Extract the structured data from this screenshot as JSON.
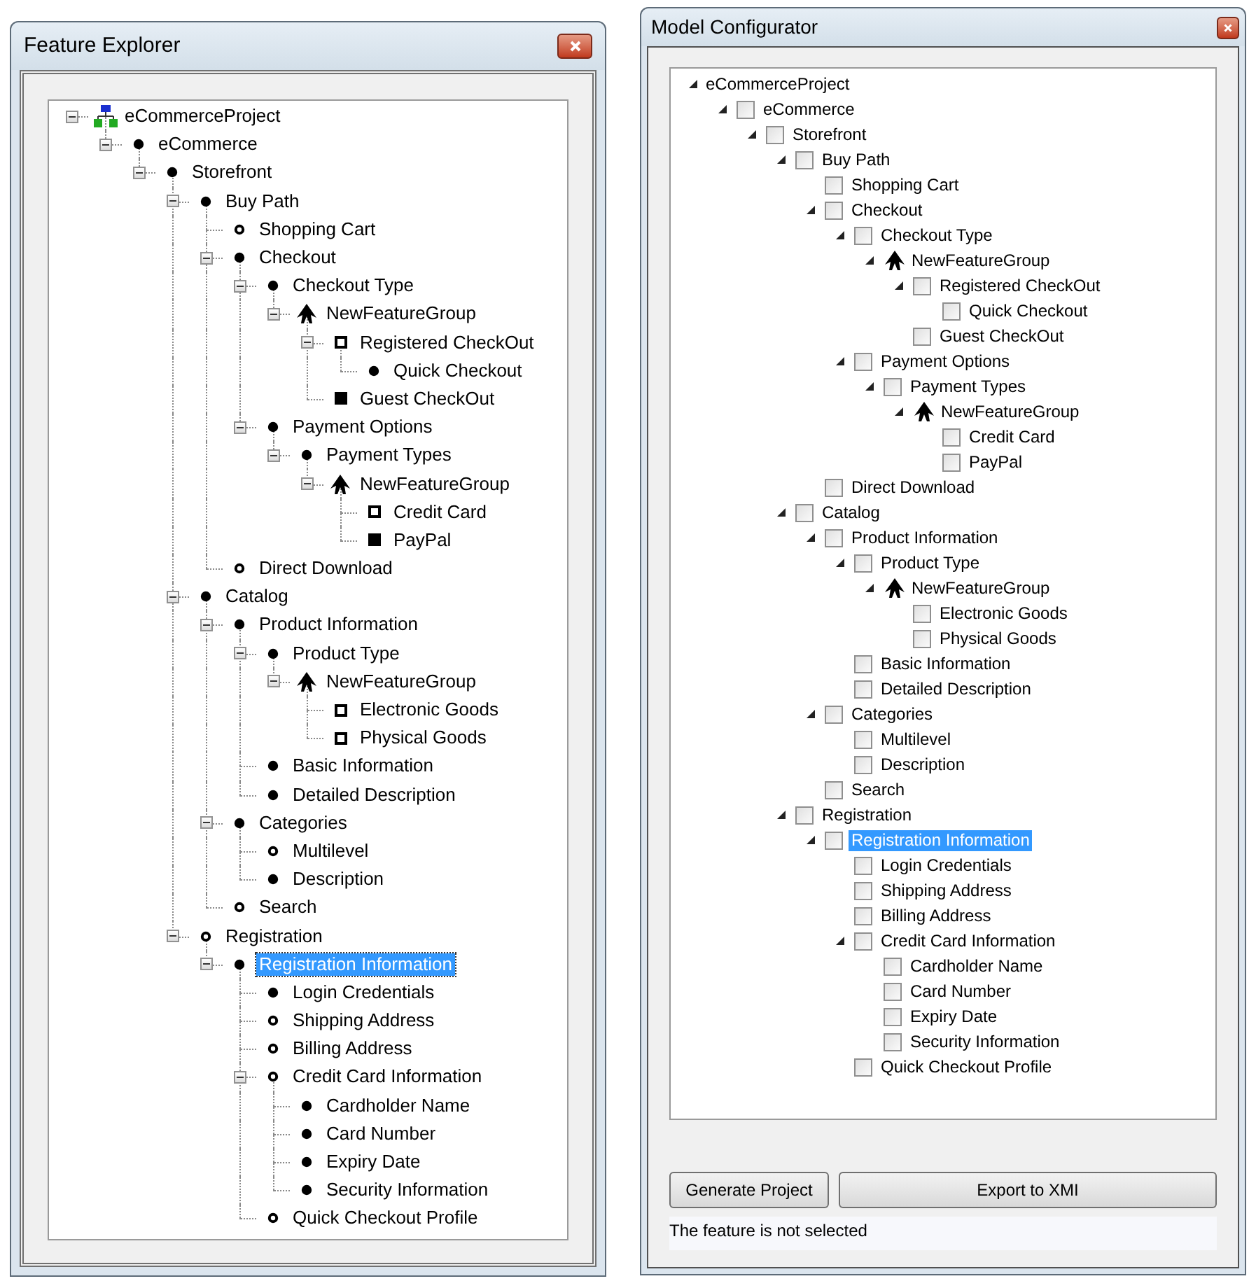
{
  "feature_explorer": {
    "title": "Feature Explorer",
    "tree": [
      {
        "label": "eCommerceProject",
        "kind": "root",
        "expanded": true,
        "selected": false,
        "children": [
          {
            "label": "eCommerce",
            "kind": "mandatory",
            "expanded": true,
            "selected": false,
            "children": [
              {
                "label": "Storefront",
                "kind": "mandatory",
                "expanded": true,
                "selected": false,
                "children": [
                  {
                    "label": "Buy Path",
                    "kind": "mandatory",
                    "expanded": true,
                    "selected": false,
                    "children": [
                      {
                        "label": "Shopping Cart",
                        "kind": "optional",
                        "selected": false
                      },
                      {
                        "label": "Checkout",
                        "kind": "mandatory",
                        "expanded": true,
                        "selected": false,
                        "children": [
                          {
                            "label": "Checkout Type",
                            "kind": "mandatory",
                            "expanded": true,
                            "selected": false,
                            "children": [
                              {
                                "label": "NewFeatureGroup",
                                "kind": "group",
                                "expanded": true,
                                "selected": false,
                                "children": [
                                  {
                                    "label": "Registered CheckOut",
                                    "kind": "or",
                                    "expanded": true,
                                    "selected": false,
                                    "children": [
                                      {
                                        "label": "Quick Checkout",
                                        "kind": "mandatory",
                                        "selected": false
                                      }
                                    ]
                                  },
                                  {
                                    "label": "Guest CheckOut",
                                    "kind": "alternative",
                                    "selected": false
                                  }
                                ]
                              }
                            ]
                          },
                          {
                            "label": "Payment Options",
                            "kind": "mandatory",
                            "expanded": true,
                            "selected": false,
                            "children": [
                              {
                                "label": "Payment Types",
                                "kind": "mandatory",
                                "expanded": true,
                                "selected": false,
                                "children": [
                                  {
                                    "label": "NewFeatureGroup",
                                    "kind": "group",
                                    "expanded": true,
                                    "selected": false,
                                    "children": [
                                      {
                                        "label": "Credit Card",
                                        "kind": "or",
                                        "selected": false
                                      },
                                      {
                                        "label": "PayPal",
                                        "kind": "alternative",
                                        "selected": false
                                      }
                                    ]
                                  }
                                ]
                              }
                            ]
                          }
                        ]
                      },
                      {
                        "label": "Direct Download",
                        "kind": "optional",
                        "selected": false
                      }
                    ]
                  },
                  {
                    "label": "Catalog",
                    "kind": "mandatory",
                    "expanded": true,
                    "selected": false,
                    "children": [
                      {
                        "label": "Product Information",
                        "kind": "mandatory",
                        "expanded": true,
                        "selected": false,
                        "children": [
                          {
                            "label": "Product Type",
                            "kind": "mandatory",
                            "expanded": true,
                            "selected": false,
                            "children": [
                              {
                                "label": "NewFeatureGroup",
                                "kind": "group",
                                "expanded": true,
                                "selected": false,
                                "children": [
                                  {
                                    "label": "Electronic Goods",
                                    "kind": "or",
                                    "selected": false
                                  },
                                  {
                                    "label": "Physical Goods",
                                    "kind": "or",
                                    "selected": false
                                  }
                                ]
                              }
                            ]
                          },
                          {
                            "label": "Basic Information",
                            "kind": "mandatory",
                            "selected": false
                          },
                          {
                            "label": "Detailed Description",
                            "kind": "mandatory",
                            "selected": false
                          }
                        ]
                      },
                      {
                        "label": "Categories",
                        "kind": "mandatory",
                        "expanded": true,
                        "selected": false,
                        "children": [
                          {
                            "label": "Multilevel",
                            "kind": "optional",
                            "selected": false
                          },
                          {
                            "label": "Description",
                            "kind": "mandatory",
                            "selected": false
                          }
                        ]
                      },
                      {
                        "label": "Search",
                        "kind": "optional",
                        "selected": false
                      }
                    ]
                  },
                  {
                    "label": "Registration",
                    "kind": "optional",
                    "expanded": true,
                    "selected": false,
                    "children": [
                      {
                        "label": "Registration Information",
                        "kind": "mandatory",
                        "expanded": true,
                        "selected": true,
                        "children": [
                          {
                            "label": "Login Credentials",
                            "kind": "mandatory",
                            "selected": false
                          },
                          {
                            "label": "Shipping Address",
                            "kind": "optional",
                            "selected": false
                          },
                          {
                            "label": "Billing Address",
                            "kind": "optional",
                            "selected": false
                          },
                          {
                            "label": "Credit Card Information",
                            "kind": "optional",
                            "expanded": true,
                            "selected": false,
                            "children": [
                              {
                                "label": "Cardholder Name",
                                "kind": "mandatory",
                                "selected": false
                              },
                              {
                                "label": "Card Number",
                                "kind": "mandatory",
                                "selected": false
                              },
                              {
                                "label": "Expiry Date",
                                "kind": "mandatory",
                                "selected": false
                              },
                              {
                                "label": "Security Information",
                                "kind": "mandatory",
                                "selected": false
                              }
                            ]
                          },
                          {
                            "label": "Quick Checkout Profile",
                            "kind": "optional",
                            "selected": false
                          }
                        ]
                      }
                    ]
                  }
                ]
              }
            ]
          }
        ]
      }
    ]
  },
  "model_configurator": {
    "title": "Model Configurator",
    "tree": [
      {
        "label": "eCommerceProject",
        "kind": "root",
        "expanded": true,
        "selected": false,
        "children": [
          {
            "label": "eCommerce",
            "kind": "feature",
            "checked": false,
            "expanded": true,
            "selected": false,
            "children": [
              {
                "label": "Storefront",
                "kind": "feature",
                "checked": false,
                "expanded": true,
                "selected": false,
                "children": [
                  {
                    "label": "Buy Path",
                    "kind": "feature",
                    "checked": false,
                    "expanded": true,
                    "selected": false,
                    "children": [
                      {
                        "label": "Shopping Cart",
                        "kind": "feature",
                        "checked": false,
                        "selected": false
                      },
                      {
                        "label": "Checkout",
                        "kind": "feature",
                        "checked": false,
                        "expanded": true,
                        "selected": false,
                        "children": [
                          {
                            "label": "Checkout Type",
                            "kind": "feature",
                            "checked": false,
                            "expanded": true,
                            "selected": false,
                            "children": [
                              {
                                "label": "NewFeatureGroup",
                                "kind": "group",
                                "expanded": true,
                                "selected": false,
                                "children": [
                                  {
                                    "label": "Registered CheckOut",
                                    "kind": "feature",
                                    "checked": false,
                                    "expanded": true,
                                    "selected": false,
                                    "children": [
                                      {
                                        "label": "Quick Checkout",
                                        "kind": "feature",
                                        "checked": false,
                                        "selected": false
                                      }
                                    ]
                                  },
                                  {
                                    "label": "Guest CheckOut",
                                    "kind": "feature",
                                    "checked": false,
                                    "selected": false
                                  }
                                ]
                              }
                            ]
                          },
                          {
                            "label": "Payment Options",
                            "kind": "feature",
                            "checked": false,
                            "expanded": true,
                            "selected": false,
                            "children": [
                              {
                                "label": "Payment Types",
                                "kind": "feature",
                                "checked": false,
                                "expanded": true,
                                "selected": false,
                                "children": [
                                  {
                                    "label": "NewFeatureGroup",
                                    "kind": "group",
                                    "expanded": true,
                                    "selected": false,
                                    "children": [
                                      {
                                        "label": "Credit Card",
                                        "kind": "feature",
                                        "checked": false,
                                        "selected": false
                                      },
                                      {
                                        "label": "PayPal",
                                        "kind": "feature",
                                        "checked": false,
                                        "selected": false
                                      }
                                    ]
                                  }
                                ]
                              }
                            ]
                          }
                        ]
                      },
                      {
                        "label": "Direct Download",
                        "kind": "feature",
                        "checked": false,
                        "selected": false
                      }
                    ]
                  },
                  {
                    "label": "Catalog",
                    "kind": "feature",
                    "checked": false,
                    "expanded": true,
                    "selected": false,
                    "children": [
                      {
                        "label": "Product Information",
                        "kind": "feature",
                        "checked": false,
                        "expanded": true,
                        "selected": false,
                        "children": [
                          {
                            "label": "Product Type",
                            "kind": "feature",
                            "checked": false,
                            "expanded": true,
                            "selected": false,
                            "children": [
                              {
                                "label": "NewFeatureGroup",
                                "kind": "group",
                                "expanded": true,
                                "selected": false,
                                "children": [
                                  {
                                    "label": "Electronic Goods",
                                    "kind": "feature",
                                    "checked": false,
                                    "selected": false
                                  },
                                  {
                                    "label": "Physical Goods",
                                    "kind": "feature",
                                    "checked": false,
                                    "selected": false
                                  }
                                ]
                              }
                            ]
                          },
                          {
                            "label": "Basic Information",
                            "kind": "feature",
                            "checked": false,
                            "selected": false
                          },
                          {
                            "label": "Detailed Description",
                            "kind": "feature",
                            "checked": false,
                            "selected": false
                          }
                        ]
                      },
                      {
                        "label": "Categories",
                        "kind": "feature",
                        "checked": false,
                        "expanded": true,
                        "selected": false,
                        "children": [
                          {
                            "label": "Multilevel",
                            "kind": "feature",
                            "checked": false,
                            "selected": false
                          },
                          {
                            "label": "Description",
                            "kind": "feature",
                            "checked": false,
                            "selected": false
                          }
                        ]
                      },
                      {
                        "label": "Search",
                        "kind": "feature",
                        "checked": false,
                        "selected": false
                      }
                    ]
                  },
                  {
                    "label": "Registration",
                    "kind": "feature",
                    "checked": false,
                    "expanded": true,
                    "selected": false,
                    "children": [
                      {
                        "label": "Registration Information",
                        "kind": "feature",
                        "checked": false,
                        "expanded": true,
                        "selected": true,
                        "children": [
                          {
                            "label": "Login Credentials",
                            "kind": "feature",
                            "checked": false,
                            "selected": false
                          },
                          {
                            "label": "Shipping Address",
                            "kind": "feature",
                            "checked": false,
                            "selected": false
                          },
                          {
                            "label": "Billing Address",
                            "kind": "feature",
                            "checked": false,
                            "selected": false
                          },
                          {
                            "label": "Credit Card Information",
                            "kind": "feature",
                            "checked": false,
                            "expanded": true,
                            "selected": false,
                            "children": [
                              {
                                "label": "Cardholder Name",
                                "kind": "feature",
                                "checked": false,
                                "selected": false
                              },
                              {
                                "label": "Card Number",
                                "kind": "feature",
                                "checked": false,
                                "selected": false
                              },
                              {
                                "label": "Expiry Date",
                                "kind": "feature",
                                "checked": false,
                                "selected": false
                              },
                              {
                                "label": "Security Information",
                                "kind": "feature",
                                "checked": false,
                                "selected": false
                              }
                            ]
                          },
                          {
                            "label": "Quick Checkout Profile",
                            "kind": "feature",
                            "checked": false,
                            "selected": false
                          }
                        ]
                      }
                    ]
                  }
                ]
              }
            ]
          }
        ]
      }
    ],
    "buttons": [
      "Generate Project",
      "Export to XMI"
    ],
    "status": "The feature is not selected"
  }
}
